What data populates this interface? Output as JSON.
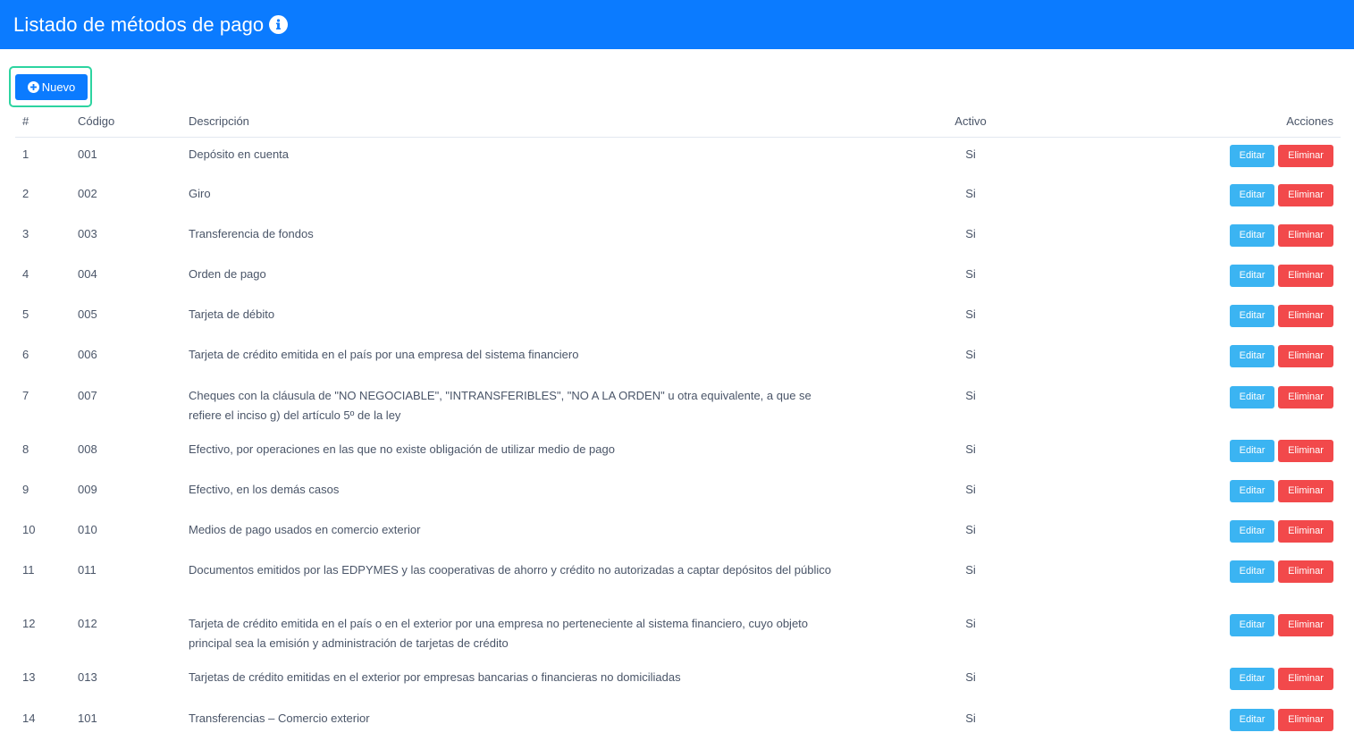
{
  "header": {
    "title": "Listado de métodos de pago",
    "info_icon": "info-circle-icon"
  },
  "toolbar": {
    "new_label": "Nuevo",
    "new_icon": "plus-circle-icon"
  },
  "table": {
    "columns": [
      "#",
      "Código",
      "Descripción",
      "Activo",
      "Acciones"
    ],
    "edit_label": "Editar",
    "delete_label": "Eliminar",
    "rows": [
      {
        "num": "1",
        "code": "001",
        "desc": "Depósito en cuenta",
        "active": "Si"
      },
      {
        "num": "2",
        "code": "002",
        "desc": "Giro",
        "active": "Si"
      },
      {
        "num": "3",
        "code": "003",
        "desc": "Transferencia de fondos",
        "active": "Si"
      },
      {
        "num": "4",
        "code": "004",
        "desc": "Orden de pago",
        "active": "Si"
      },
      {
        "num": "5",
        "code": "005",
        "desc": "Tarjeta de débito",
        "active": "Si"
      },
      {
        "num": "6",
        "code": "006",
        "desc": "Tarjeta de crédito emitida en el país por una empresa del sistema financiero",
        "active": "Si"
      },
      {
        "num": "7",
        "code": "007",
        "desc": "Cheques con la cláusula de \"NO NEGOCIABLE\", \"INTRANSFERIBLES\", \"NO A LA ORDEN\" u otra equivalente, a que se refiere el inciso g) del artículo 5º de la ley",
        "active": "Si"
      },
      {
        "num": "8",
        "code": "008",
        "desc": "Efectivo, por operaciones en las que no existe obligación de utilizar medio de pago",
        "active": "Si"
      },
      {
        "num": "9",
        "code": "009",
        "desc": "Efectivo, en los demás casos",
        "active": "Si"
      },
      {
        "num": "10",
        "code": "010",
        "desc": "Medios de pago usados en comercio exterior",
        "active": "Si"
      },
      {
        "num": "11",
        "code": "011",
        "desc": "Documentos emitidos por las EDPYMES y las cooperativas de ahorro y crédito no autorizadas a captar depósitos del público",
        "active": "Si"
      },
      {
        "num": "12",
        "code": "012",
        "desc": "Tarjeta de crédito emitida en el país o en el exterior por una empresa no perteneciente al sistema financiero, cuyo objeto principal sea la emisión y administración de tarjetas de crédito",
        "active": "Si"
      },
      {
        "num": "13",
        "code": "013",
        "desc": "Tarjetas de crédito emitidas en el exterior por empresas bancarias o financieras no domiciliadas",
        "active": "Si"
      },
      {
        "num": "14",
        "code": "101",
        "desc": "Transferencias – Comercio exterior",
        "active": "Si"
      }
    ]
  },
  "colors": {
    "primary": "#0b7bff",
    "edit": "#3bb4f2",
    "delete": "#f2494b",
    "focus_ring": "#2dd4a0"
  }
}
